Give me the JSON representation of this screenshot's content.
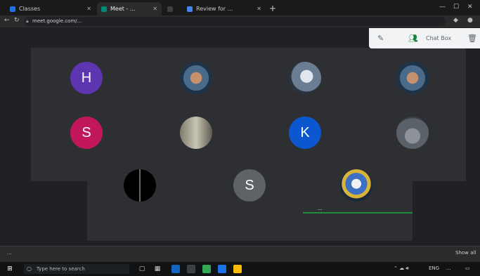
{
  "browser": {
    "tabs": [
      {
        "label": "Classes",
        "favicon_color": "#1a73e8"
      },
      {
        "label": "Meet - ...",
        "favicon_color": "#00897b"
      },
      {
        "label": "...",
        "favicon_color": "#3c4043"
      },
      {
        "label": "Review for ...",
        "favicon_color": "#4285f4"
      }
    ],
    "new_tab_label": "+",
    "window_controls": [
      "—",
      "☐",
      "✕"
    ],
    "address": "meet.google.com/..."
  },
  "meet": {
    "controls": {
      "label": "Chat Box"
    },
    "participants": [
      {
        "initial": "H",
        "color": "#5e35b1"
      },
      {
        "initial": "",
        "color": ""
      },
      {
        "initial": "",
        "color": ""
      },
      {
        "initial": "",
        "color": ""
      },
      {
        "initial": "S",
        "color": "#c2185b"
      },
      {
        "initial": "",
        "color": ""
      },
      {
        "initial": "K",
        "color": "#0b57d0"
      },
      {
        "initial": "",
        "color": ""
      },
      {
        "initial": "",
        "color": ""
      },
      {
        "initial": "S",
        "color": "#5f6368"
      },
      {
        "initial": "",
        "color": ""
      }
    ],
    "active_speaker_name": "...",
    "active_speaker_color": "#1e8e3e"
  },
  "downloads": {
    "item": "...",
    "show_all": "Show all"
  },
  "taskbar": {
    "search_placeholder": "Type here to search",
    "tray_text": "ENG",
    "time": "...",
    "date": "..."
  }
}
